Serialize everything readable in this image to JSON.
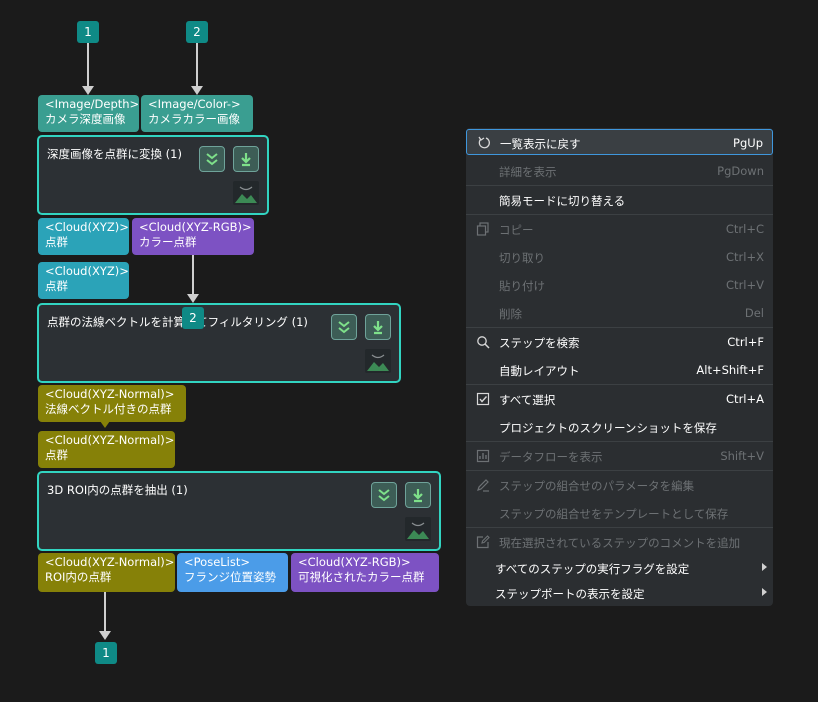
{
  "badges": {
    "in1": "1",
    "in2": "2",
    "mid": "2",
    "out": "1"
  },
  "ports": {
    "depth_type": "<Image/Depth>",
    "depth_name": "カメラ深度画像",
    "color_type": "<Image/Color->",
    "color_name": "カメラカラー画像",
    "cloud_xyz_type": "<Cloud(XYZ)>",
    "cloud_xyz_name": "点群",
    "cloud_rgb_type": "<Cloud(XYZ-RGB)>",
    "cloud_rgb_name": "カラー点群",
    "cloud_in_type": "<Cloud(XYZ)>",
    "cloud_in_name": "点群",
    "normal_out_type": "<Cloud(XYZ-Normal)>",
    "normal_out_name": "法線ベクトル付きの点群",
    "normal_in_type": "<Cloud(XYZ-Normal)>",
    "normal_in_name": "点群",
    "roi_type": "<Cloud(XYZ-Normal)>",
    "roi_name": "ROI内の点群",
    "pose_type": "<PoseList>",
    "pose_name": "フランジ位置姿勢",
    "vis_type": "<Cloud(XYZ-RGB)>",
    "vis_name": "可視化されたカラー点群"
  },
  "steps": {
    "s1": "深度画像を点群に変換 (1)",
    "s2": "点群の法線ベクトルを計算してフィルタリング (1)",
    "s3": "3D ROI内の点群を抽出 (1)"
  },
  "menu": {
    "items": [
      {
        "label": "一覧表示に戻す",
        "shortcut": "PgUp",
        "icon": "undo-icon"
      },
      {
        "label": "詳細を表示",
        "shortcut": "PgDown"
      },
      {
        "label": "簡易モードに切り替える",
        "shortcut": ""
      },
      {
        "label": "コピー",
        "shortcut": "Ctrl+C",
        "icon": "copy-icon"
      },
      {
        "label": "切り取り",
        "shortcut": "Ctrl+X"
      },
      {
        "label": "貼り付け",
        "shortcut": "Ctrl+V"
      },
      {
        "label": "削除",
        "shortcut": "Del"
      },
      {
        "label": "ステップを検索",
        "shortcut": "Ctrl+F",
        "icon": "search-icon"
      },
      {
        "label": "自動レイアウト",
        "shortcut": "Alt+Shift+F"
      },
      {
        "label": "すべて選択",
        "shortcut": "Ctrl+A",
        "icon": "select-all-icon"
      },
      {
        "label": "プロジェクトのスクリーンショットを保存",
        "shortcut": ""
      },
      {
        "label": "データフローを表示",
        "shortcut": "Shift+V",
        "icon": "chart-icon"
      },
      {
        "label": "ステップの組合せのパラメータを編集",
        "shortcut": "",
        "icon": "edit-icon"
      },
      {
        "label": "ステップの組合せをテンプレートとして保存",
        "shortcut": ""
      },
      {
        "label": "現在選択されているステップのコメントを追加",
        "shortcut": "",
        "icon": "comment-icon"
      },
      {
        "label": "すべてのステップの実行フラグを設定",
        "shortcut": ""
      },
      {
        "label": "ステップポートの表示を設定",
        "shortcut": ""
      }
    ]
  },
  "colors": {
    "accent": "#32d4c1",
    "badge": "#0f8a86",
    "menu_highlight": "#3f97dd"
  }
}
